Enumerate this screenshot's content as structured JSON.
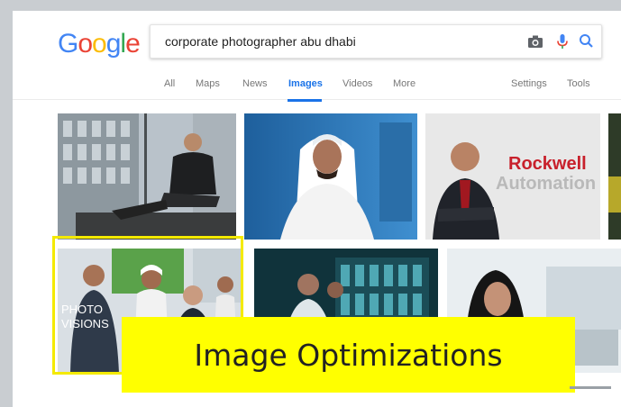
{
  "logo": {
    "letters": [
      "G",
      "o",
      "o",
      "g",
      "l",
      "e"
    ],
    "colors": [
      "#4285F4",
      "#EA4335",
      "#FBBC05",
      "#4285F4",
      "#34A853",
      "#EA4335"
    ]
  },
  "search": {
    "query": "corporate photographer abu dhabi"
  },
  "icons": {
    "camera": "camera-icon",
    "mic": "microphone-icon",
    "search": "search-icon"
  },
  "nav": {
    "tabs": [
      {
        "label": "All",
        "active": false
      },
      {
        "label": "Maps",
        "active": false
      },
      {
        "label": "News",
        "active": false
      },
      {
        "label": "Images",
        "active": true
      },
      {
        "label": "Videos",
        "active": false
      },
      {
        "label": "More",
        "active": false
      }
    ],
    "settings": "Settings",
    "tools": "Tools"
  },
  "results": {
    "watermark_text": "PHOTO VISIONS",
    "sign_text": "Rockwell Automation"
  },
  "caption": "Image Optimizations",
  "colors": {
    "accent": "#1a73e8",
    "highlight": "#ffff00",
    "frame": "#f4ea00"
  }
}
